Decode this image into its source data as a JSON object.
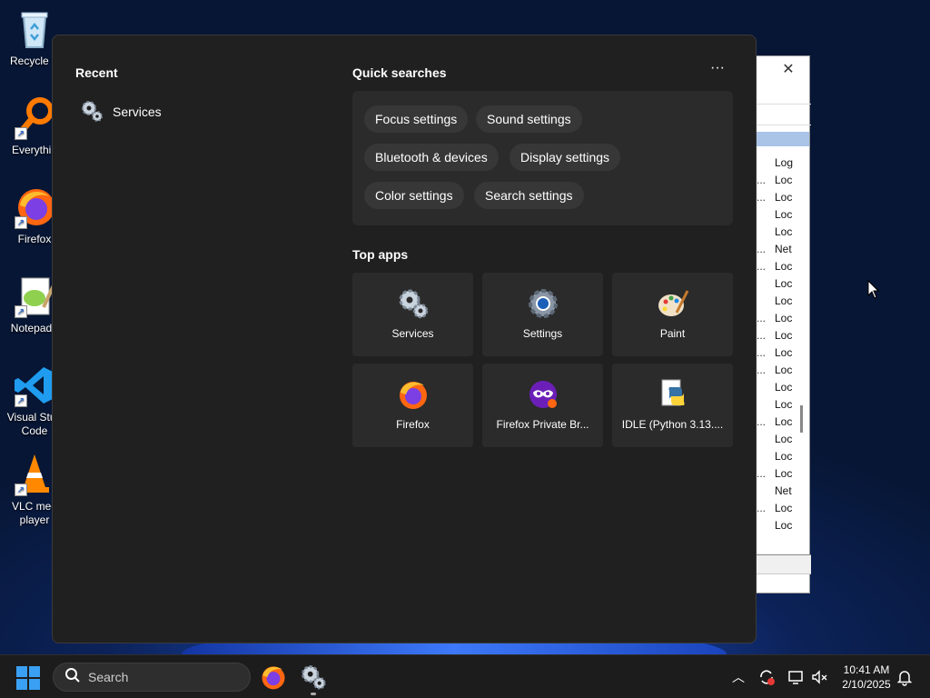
{
  "desktop": {
    "icons": [
      {
        "label": "Recycle B",
        "icon": "recycle-bin-icon"
      },
      {
        "label": "Everythin",
        "icon": "everything-search-icon"
      },
      {
        "label": "Firefox",
        "icon": "firefox-icon"
      },
      {
        "label": "Notepad+",
        "icon": "notepadpp-icon"
      },
      {
        "label": "Visual Stud Code",
        "icon": "vscode-icon"
      },
      {
        "label": "VLC med player",
        "icon": "vlc-icon"
      }
    ]
  },
  "background_window": {
    "close_label": "✕",
    "rows": [
      {
        "dots": "",
        "value": "Log"
      },
      {
        "dots": "...",
        "value": "Loc"
      },
      {
        "dots": "...",
        "value": "Loc"
      },
      {
        "dots": "",
        "value": "Loc"
      },
      {
        "dots": "",
        "value": "Loc"
      },
      {
        "dots": "...",
        "value": "Net"
      },
      {
        "dots": "...",
        "value": "Loc"
      },
      {
        "dots": "",
        "value": "Loc"
      },
      {
        "dots": "",
        "value": "Loc"
      },
      {
        "dots": "...",
        "value": "Loc"
      },
      {
        "dots": "...",
        "value": "Loc"
      },
      {
        "dots": "...",
        "value": "Loc"
      },
      {
        "dots": "...",
        "value": "Loc"
      },
      {
        "dots": "",
        "value": "Loc"
      },
      {
        "dots": "",
        "value": "Loc"
      },
      {
        "dots": "...",
        "value": "Loc"
      },
      {
        "dots": "",
        "value": "Loc"
      },
      {
        "dots": "",
        "value": "Loc"
      },
      {
        "dots": "...",
        "value": "Loc"
      },
      {
        "dots": "",
        "value": "Net"
      },
      {
        "dots": "...",
        "value": "Loc"
      },
      {
        "dots": "",
        "value": "Loc"
      }
    ]
  },
  "panel": {
    "recent_heading": "Recent",
    "recent_items": [
      {
        "label": "Services",
        "icon": "gears-icon"
      }
    ],
    "quick_searches_heading": "Quick searches",
    "more_label": "···",
    "quick_searches": [
      "Focus settings",
      "Sound settings",
      "Bluetooth & devices",
      "Display settings",
      "Color settings",
      "Search settings"
    ],
    "top_apps_heading": "Top apps",
    "top_apps": [
      {
        "label": "Services",
        "icon": "gears-icon"
      },
      {
        "label": "Settings",
        "icon": "settings-gear-icon"
      },
      {
        "label": "Paint",
        "icon": "paint-palette-icon"
      },
      {
        "label": "Firefox",
        "icon": "firefox-icon"
      },
      {
        "label": "Firefox Private Br...",
        "icon": "firefox-private-icon"
      },
      {
        "label": "IDLE (Python 3.13....",
        "icon": "python-idle-icon"
      }
    ]
  },
  "taskbar": {
    "search_placeholder": "Search",
    "clock_time": "10:41 AM",
    "clock_date": "2/10/2025",
    "tray_chevron": "︿"
  },
  "colors": {
    "panel_bg": "#202020",
    "tile_bg": "#2b2b2b",
    "chip_bg": "#373737",
    "windows_blue": "#3aa0f3"
  }
}
